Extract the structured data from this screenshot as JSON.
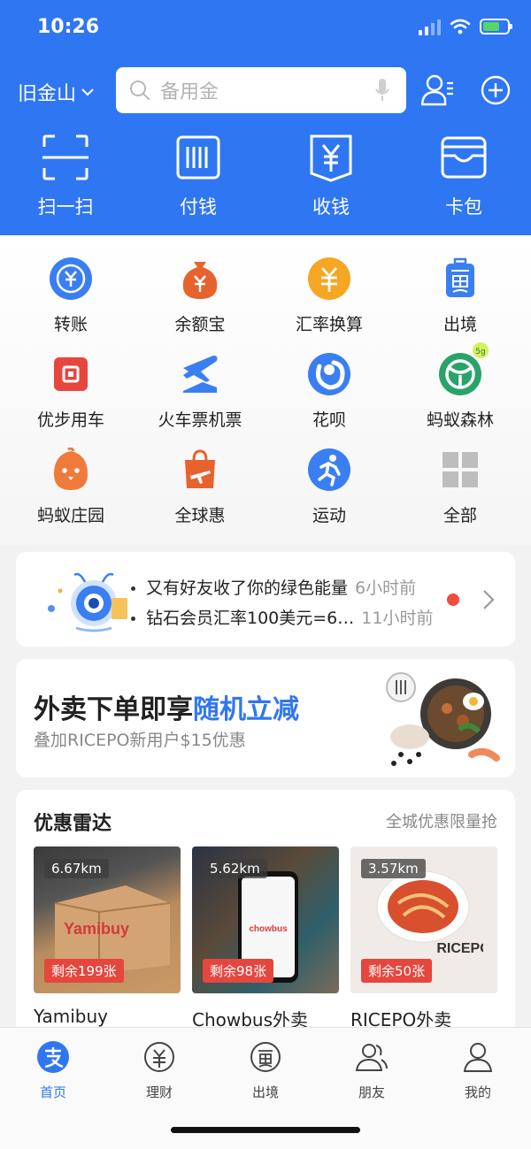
{
  "status": {
    "time": "10:26"
  },
  "header": {
    "city": "旧金山",
    "search_placeholder": "备用金",
    "quick_actions": [
      {
        "label": "扫一扫",
        "icon": "scan-icon"
      },
      {
        "label": "付钱",
        "icon": "pay-barcode-icon"
      },
      {
        "label": "收钱",
        "icon": "receive-money-icon"
      },
      {
        "label": "卡包",
        "icon": "card-wallet-icon"
      }
    ]
  },
  "grid": [
    {
      "label": "转账",
      "icon": "transfer-icon",
      "color": "#3a7ff2"
    },
    {
      "label": "余额宝",
      "icon": "yuebao-icon",
      "color": "#e8622e"
    },
    {
      "label": "汇率换算",
      "icon": "exchange-rate-icon",
      "color": "#f5a623"
    },
    {
      "label": "出境",
      "icon": "travel-icon",
      "color": "#3a7ff2"
    },
    {
      "label": "优步用车",
      "icon": "uber-icon",
      "color": "#e5463e"
    },
    {
      "label": "火车票机票",
      "icon": "train-plane-icon",
      "color": "#3a7ff2"
    },
    {
      "label": "花呗",
      "icon": "huabei-icon",
      "color": "#3a7ff2"
    },
    {
      "label": "蚂蚁森林",
      "icon": "ant-forest-icon",
      "color": "#2aa36b",
      "badge": "5g"
    },
    {
      "label": "蚂蚁庄园",
      "icon": "ant-farm-icon",
      "color": "#f07a3a"
    },
    {
      "label": "全球惠",
      "icon": "global-deals-icon",
      "color": "#e8622e"
    },
    {
      "label": "运动",
      "icon": "sport-icon",
      "color": "#3a7ff2"
    },
    {
      "label": "全部",
      "icon": "all-apps-icon",
      "color": "#bdbdbd"
    }
  ],
  "notice": {
    "items": [
      {
        "text": "又有好友收了你的绿色能量",
        "time": "6小时前"
      },
      {
        "text": "钻石会员汇率100美元=6…",
        "time": "11小时前"
      }
    ]
  },
  "promo": {
    "title_main": "外卖下单即享",
    "title_highlight": "随机立减",
    "subtitle": "叠加RICEPO新用户$15优惠"
  },
  "radar": {
    "title": "优惠雷达",
    "more": "全城优惠限量抢",
    "deals": [
      {
        "name": "Yamibuy",
        "distance": "6.67km",
        "remain": "剩余199张",
        "brand_text": "Yamibuy"
      },
      {
        "name": "Chowbus外卖",
        "distance": "5.62km",
        "remain": "剩余98张",
        "brand_text": "chowbus"
      },
      {
        "name": "RICEPO外卖",
        "distance": "3.57km",
        "remain": "剩余50张",
        "brand_text": "RICEPO"
      }
    ]
  },
  "tabbar": [
    {
      "label": "首页",
      "icon": "home-alipay-icon",
      "active": true
    },
    {
      "label": "理财",
      "icon": "finance-icon",
      "active": false
    },
    {
      "label": "出境",
      "icon": "travel-abroad-icon",
      "active": false
    },
    {
      "label": "朋友",
      "icon": "friends-icon",
      "active": false
    },
    {
      "label": "我的",
      "icon": "profile-icon",
      "active": false
    }
  ],
  "colors": {
    "brand_blue": "#2f76f2",
    "alert_red": "#e5463e"
  }
}
